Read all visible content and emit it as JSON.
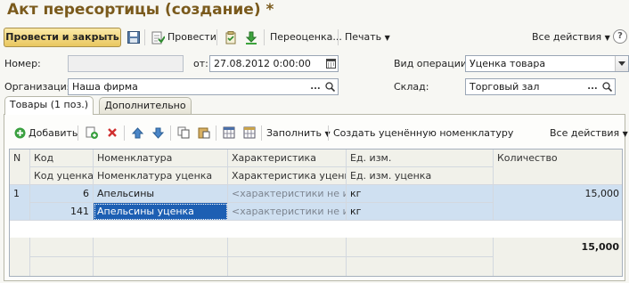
{
  "window": {
    "title": "Акт пересортицы (создание) *"
  },
  "toolbar": {
    "post_close_label": "Провести и закрыть",
    "post_label": "Провести",
    "revaluation_label": "Переоценка...",
    "print_label": "Печать",
    "all_actions_label": "Все действия"
  },
  "form": {
    "number_label": "Номер:",
    "number_value": "",
    "date_label": "от:",
    "date_value": "27.08.2012  0:00:00",
    "operation_label": "Вид операции:",
    "operation_value": "Уценка товара",
    "org_label": "Организация:",
    "org_value": "Наша фирма",
    "warehouse_label": "Склад:",
    "warehouse_value": "Торговый зал"
  },
  "tabs": [
    {
      "label": "Товары (1 поз.)",
      "active": true
    },
    {
      "label": "Дополнительно",
      "active": false
    }
  ],
  "table_toolbar": {
    "add_label": "Добавить",
    "fill_label": "Заполнить",
    "create_label": "Создать уценённую номенклатуру",
    "all_actions_label": "Все действия"
  },
  "table": {
    "headers": {
      "n": "N",
      "code": "Код",
      "code_marked": "Код уценка",
      "item": "Номенклатура",
      "item_marked": "Номенклатура уценка",
      "char": "Характеристика",
      "char_marked": "Характеристика уценка",
      "unit": "Ед. изм.",
      "unit_marked": "Ед. изм. уценка",
      "qty": "Количество"
    },
    "rows": [
      {
        "n": "1",
        "code": "6",
        "code_marked": "141",
        "item": "Апельсины",
        "item_marked": "Апельсины уценка",
        "char": "<характеристики не и...",
        "char_marked": "<характеристики не и...",
        "unit": "кг",
        "unit_marked": "кг",
        "qty": "15,000"
      }
    ],
    "total_qty": "15,000"
  },
  "colors": {
    "title": "#7a5a1c",
    "primary_button": "#e9c75f",
    "selected_row": "#cfe0f1",
    "selected_cell": "#1d5fb3",
    "delete_icon": "#d03030",
    "add_icon": "#3aa040"
  },
  "icons": [
    "save-icon",
    "post-icon",
    "check-doc-icon",
    "download-arrow-icon",
    "help-icon",
    "calendar-icon",
    "search-icon",
    "select-dots-icon",
    "dropdown-arrow-icon",
    "add-icon",
    "copy-icon",
    "delete-icon",
    "up-icon",
    "down-icon"
  ]
}
